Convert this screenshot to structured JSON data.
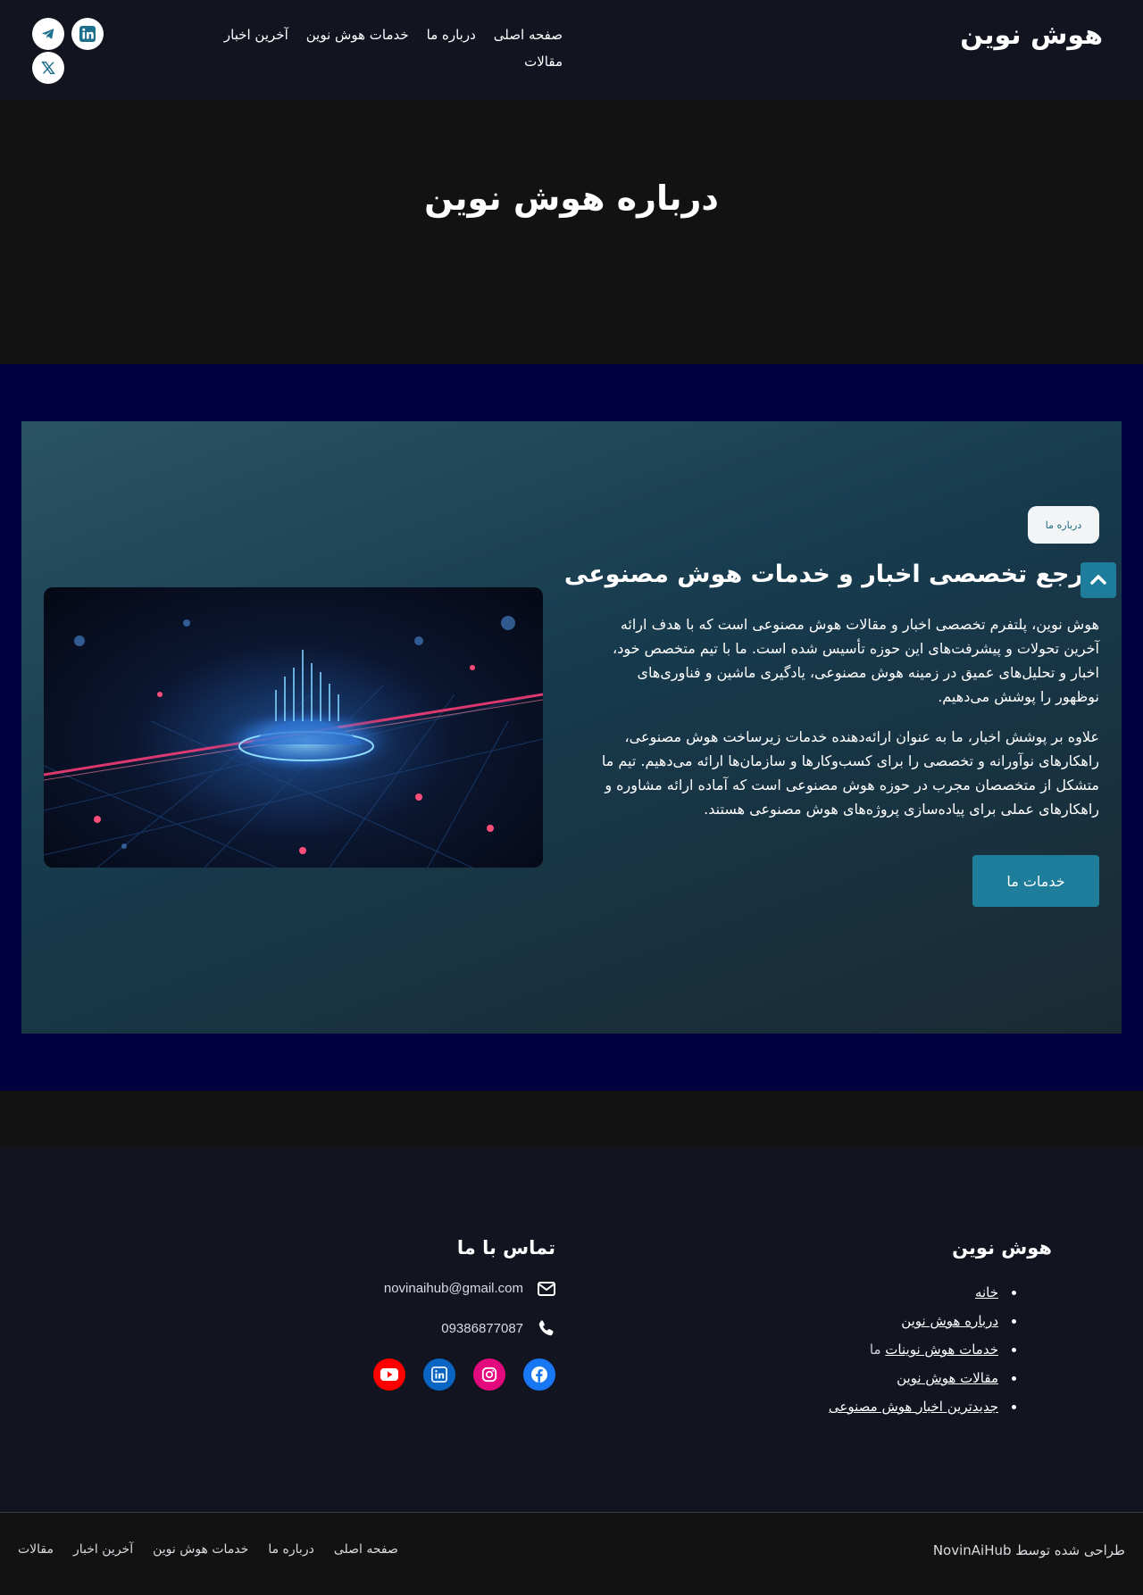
{
  "header": {
    "logo": "هوش نوین",
    "nav": [
      "صفحه اصلی",
      "درباره ما",
      "خدمات هوش نوین",
      "آخرین اخبار"
    ],
    "nav_second_row": "مقالات",
    "social_icons": [
      "linkedin-icon",
      "telegram-icon",
      "x-icon"
    ]
  },
  "hero": {
    "title": "درباره هوش نوین"
  },
  "about": {
    "badge": "درباره ما",
    "heading": "مرجع تخصصی اخبار و خدمات هوش مصنوعی",
    "paragraph1": "هوش نوین، پلتفرم تخصصی اخبار و مقالات هوش مصنوعی است که با هدف ارائه آخرین تحولات و پیشرفت‌های این حوزه تأسیس شده است. ما با تیم متخصص خود، اخبار و تحلیل‌های عمیق در زمینه هوش مصنوعی، یادگیری ماشین و فناوری‌های نوظهور را پوشش می‌دهیم.",
    "paragraph2": "علاوه بر پوشش اخبار، ما به عنوان ارائه‌دهنده خدمات زیرساخت هوش مصنوعی، راهکارهای نوآورانه و تخصصی را برای کسب‌وکارها و سازمان‌ها ارائه می‌دهیم. تیم ما متشکل از متخصصان مجرب در حوزه هوش مصنوعی است که آماده ارائه مشاوره و راهکارهای عملی برای پیاده‌سازی پروژه‌های هوش مصنوعی هستند.",
    "cta": "خدمات ما"
  },
  "footer": {
    "brand_title": "هوش نوین",
    "links": [
      {
        "label": "خانه",
        "suffix": ""
      },
      {
        "label": "درباره هوش نوین",
        "suffix": ""
      },
      {
        "label": "خدمات هوش نوینات",
        "suffix": " ما"
      },
      {
        "label": "مقالات هوش نوین",
        "suffix": ""
      },
      {
        "label": "جدیدترین اخبار هوش مصنوعی",
        "suffix": ""
      }
    ],
    "contact_title": "تماس با ما",
    "email": "novinaihub@gmail.com",
    "phone": "09386877087",
    "social": [
      "facebook-icon",
      "instagram-icon",
      "linkedin-icon",
      "youtube-icon"
    ],
    "colors": {
      "facebook": "#1877f2",
      "instagram": "#e4097d",
      "linkedin": "#0a66c2",
      "youtube": "#ff0000"
    }
  },
  "bottom": {
    "credit": "طراحی شده توسط NovinAiHub",
    "nav": [
      "صفحه اصلی",
      "درباره ما",
      "خدمات هوش نوین",
      "آخرین اخبار",
      "مقالات"
    ]
  }
}
